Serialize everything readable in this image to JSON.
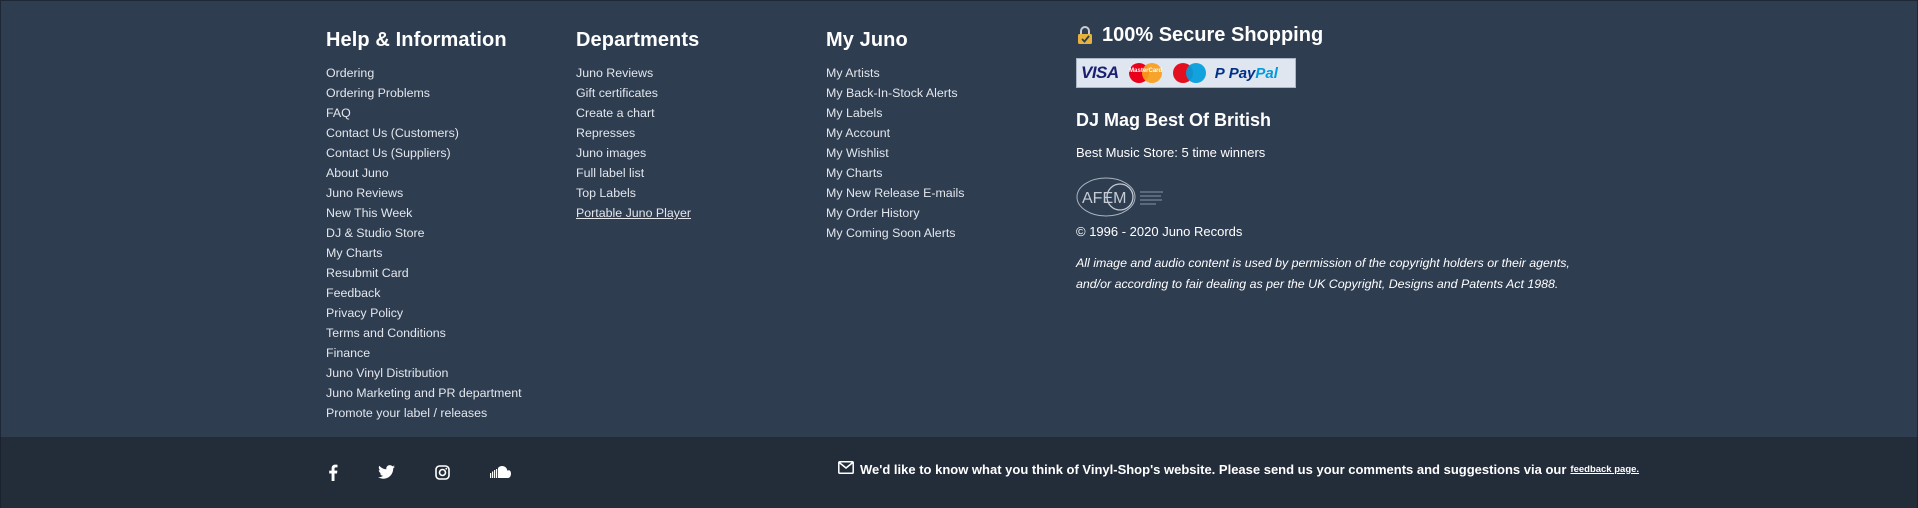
{
  "help": {
    "title": "Help & Information",
    "items": [
      "Ordering",
      "Ordering Problems",
      "FAQ",
      "Contact Us (Customers)",
      "Contact Us (Suppliers)",
      "About Juno",
      "Juno Reviews",
      "New This Week",
      "DJ & Studio Store",
      "My Charts",
      "Resubmit Card",
      "Feedback",
      "Privacy Policy",
      "Terms and Conditions",
      "Finance",
      "Juno Vinyl Distribution",
      "Juno Marketing and PR department",
      "Promote your label / releases"
    ]
  },
  "departments": {
    "title": "Departments",
    "items": [
      "Juno Reviews",
      "Gift certificates",
      "Create a chart",
      "Represses",
      "Juno images",
      "Full label list",
      "Top Labels",
      "Portable Juno Player"
    ]
  },
  "myjuno": {
    "title": "My Juno",
    "items": [
      "My Artists",
      "My Back-In-Stock Alerts",
      "My Labels",
      "My Account",
      "My Wishlist",
      "My Charts",
      "My New Release E-mails",
      "My Order History",
      "My Coming Soon Alerts"
    ]
  },
  "secure": {
    "title": "100% Secure Shopping",
    "cards": {
      "visa": "VISA",
      "mastercard": "MasterCard",
      "paypal_a": "Pay",
      "paypal_b": "Pal",
      "paypal_mark": "P"
    }
  },
  "djmag": {
    "title": "DJ Mag Best Of British",
    "winners": "Best Music Store: 5 time winners"
  },
  "afem": {
    "logo_text": "AFEM"
  },
  "copyright": "© 1996 - 2020 Juno Records",
  "legal": {
    "line1": "All image and audio content is used by permission of the copyright holders or their agents,",
    "line2": "and/or according to fair dealing as per the UK Copyright, Designs and Patents Act 1988."
  },
  "bottom": {
    "social_icons": [
      "facebook-icon",
      "twitter-icon",
      "instagram-icon",
      "soundcloud-icon"
    ],
    "feedback_text": "We'd like to know what you think of Vinyl-Shop's website. Please send us your comments and suggestions via our",
    "feedback_link": "feedback page."
  },
  "colors": {
    "main_bg": "#2f3d51",
    "bottom_bg": "#232c39",
    "text": "#e3e7ec"
  }
}
